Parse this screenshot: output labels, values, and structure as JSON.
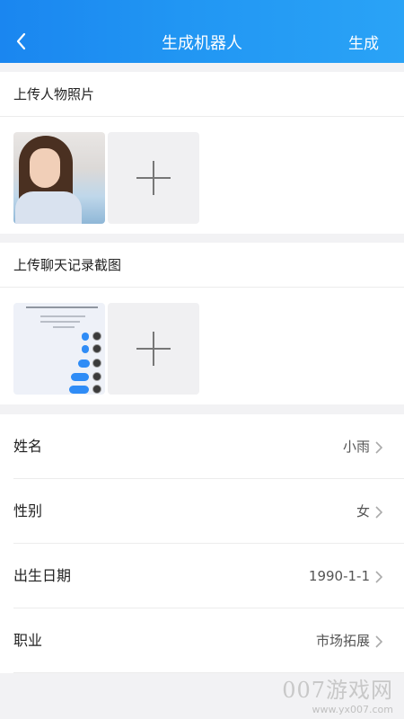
{
  "nav": {
    "title": "生成机器人",
    "action": "生成",
    "back_icon": "chevron-left-icon"
  },
  "photo_section": {
    "heading": "上传人物照片"
  },
  "chat_section": {
    "heading": "上传聊天记录截图"
  },
  "fields": [
    {
      "label": "姓名",
      "value": "小雨"
    },
    {
      "label": "性别",
      "value": "女"
    },
    {
      "label": "出生日期",
      "value": "1990-1-1"
    },
    {
      "label": "职业",
      "value": "市场拓展"
    }
  ],
  "watermark": {
    "brand": "007游戏网",
    "url": "www.yx007.com"
  }
}
